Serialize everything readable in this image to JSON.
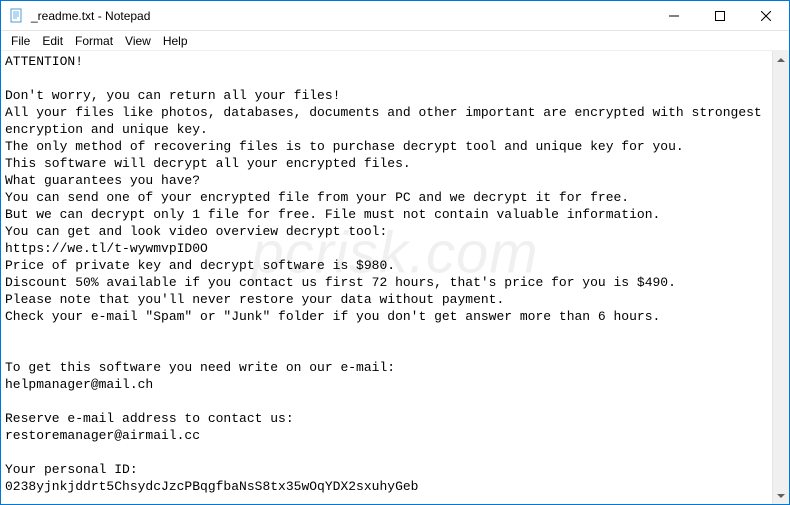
{
  "window": {
    "title": "_readme.txt - Notepad"
  },
  "menu": {
    "file": "File",
    "edit": "Edit",
    "format": "Format",
    "view": "View",
    "help": "Help"
  },
  "content": {
    "text": "ATTENTION!\n\nDon't worry, you can return all your files!\nAll your files like photos, databases, documents and other important are encrypted with strongest encryption and unique key.\nThe only method of recovering files is to purchase decrypt tool and unique key for you.\nThis software will decrypt all your encrypted files.\nWhat guarantees you have?\nYou can send one of your encrypted file from your PC and we decrypt it for free.\nBut we can decrypt only 1 file for free. File must not contain valuable information.\nYou can get and look video overview decrypt tool:\nhttps://we.tl/t-wywmvpID0O\nPrice of private key and decrypt software is $980.\nDiscount 50% available if you contact us first 72 hours, that's price for you is $490.\nPlease note that you'll never restore your data without payment.\nCheck your e-mail \"Spam\" or \"Junk\" folder if you don't get answer more than 6 hours.\n\n\nTo get this software you need write on our e-mail:\nhelpmanager@mail.ch\n\nReserve e-mail address to contact us:\nrestoremanager@airmail.cc\n\nYour personal ID:\n0238yjnkjddrt5ChsydcJzcPBqgfbaNsS8tx35wOqYDX2sxuhyGeb"
  },
  "watermark": "pcrisk.com"
}
